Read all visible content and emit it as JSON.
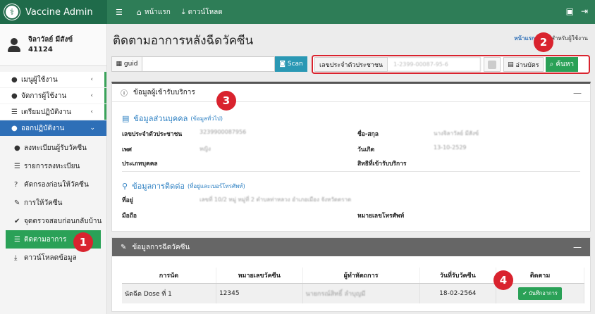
{
  "brand": {
    "title": "Vaccine Admin",
    "logo_icon": "caduceus-icon"
  },
  "topbar": {
    "menu_icon": "hamburger-icon",
    "items": [
      {
        "label": "หน้าแรก",
        "icon": "home-icon"
      },
      {
        "label": "ดาวน์โหลด",
        "icon": "download-icon"
      }
    ],
    "right_icons": [
      "id-card-icon",
      "sign-out-icon"
    ]
  },
  "user": {
    "name": "จิลาวัลย์ มีสังข์",
    "id": "41124"
  },
  "sidebar": {
    "items": [
      {
        "label": "เมนูผู้ใช้งาน",
        "icon": "user-icon",
        "arrow": "‹"
      },
      {
        "label": "จัดการผู้ใช้งาน",
        "icon": "users-cog-icon",
        "arrow": "‹"
      },
      {
        "label": "เตรียมปฏิบัติงาน",
        "icon": "list-icon",
        "arrow": "‹"
      },
      {
        "label": "ออกปฏิบัติงาน",
        "icon": "user-doctor-icon",
        "arrow": "⌄"
      }
    ],
    "subitems": [
      {
        "label": "ลงทะเบียนผู้รับวัคซีน",
        "icon": "user-plus-icon"
      },
      {
        "label": "รายการลงทะเบียน",
        "icon": "list-icon"
      },
      {
        "label": "คัดกรองก่อนให้วัคซีน",
        "icon": "question-circle-icon"
      },
      {
        "label": "การให้วัคซีน",
        "icon": "syringe-icon"
      },
      {
        "label": "จุดตรวจสอบก่อนกลับบ้าน",
        "icon": "check-circle-icon"
      },
      {
        "label": "ติดตามอาการ",
        "icon": "list-check-icon"
      },
      {
        "label": "ดาวน์โหลดข้อมูล",
        "icon": "download-icon"
      }
    ]
  },
  "page": {
    "title": "ติดตามอาการหลังฉีดวัคซีน",
    "breadcrumb_home": "หน้าแรก",
    "breadcrumb_current": "คู่มือสำหรับผู้ใช้งาน"
  },
  "guid": {
    "label": "guid",
    "value": "",
    "scan_label": "Scan"
  },
  "search": {
    "id_label": "เลขประจำตัวประชาชน",
    "id_value": "1-2399-00087-95-6",
    "card_button": "อ่านบัตร",
    "search_button": "ค้นหา"
  },
  "info_panel": {
    "title": "ข้อมูลผู้เข้ารับบริการ",
    "personal_title": "ข้อมูลส่วนบุคคล",
    "personal_sub": "(ข้อมูลทั่วไป)",
    "fields": {
      "id_label": "เลขประจำตัวประชาชน",
      "id_value": "3239900087956",
      "name_label": "ชื่อ-สกุล",
      "name_value": "นางจิลาวัลย์ มีสังข์",
      "sex_label": "เพศ",
      "sex_value": "หญิง",
      "dob_label": "วันเกิด",
      "dob_value": "13-10-2529",
      "type_label": "ประเภทบุคคล",
      "type_value": "",
      "rights_label": "สิทธิที่เข้ารับบริการ",
      "rights_value": ""
    },
    "contact_title": "ข้อมูลการติดต่อ",
    "contact_sub": "(ที่อยู่และเบอร์โทรศัพท์)",
    "contact": {
      "address_label": "ที่อยู่",
      "address_value": "เลขที่ 10/2 หมู่ หมู่ที่ 2 ตำบลท่าหลวง อำเภอเมือง จังหวัดตราด",
      "mobile_label": "มือถือ",
      "mobile_value": "",
      "phone_label": "หมายเลขโทรศัพท์",
      "phone_value": ""
    }
  },
  "vacc_panel": {
    "title": "ข้อมูลการฉีดวัคซีน",
    "columns": [
      "การนัด",
      "หมายเลขวัคซีน",
      "ผู้ทำหัตถการ",
      "วันที่รับวัคซีน",
      "ติดตาม"
    ],
    "rows": [
      {
        "appointment": "นัดฉีด Dose ที่ 1",
        "vaccine_no": "12345",
        "operator": "นายกรณ์สิทธิ์ ลำบุญมี",
        "date": "18-02-2564",
        "action": "บันทึกอาการ"
      }
    ]
  },
  "badges": [
    "1",
    "2",
    "3",
    "4"
  ],
  "colors": {
    "brand": "#1f6b4a",
    "topbar": "#2e7d57",
    "accent_green": "#2aa157",
    "accent_blue": "#2e6fb7",
    "badge_red": "#d9232e",
    "scan": "#2a98b4"
  }
}
